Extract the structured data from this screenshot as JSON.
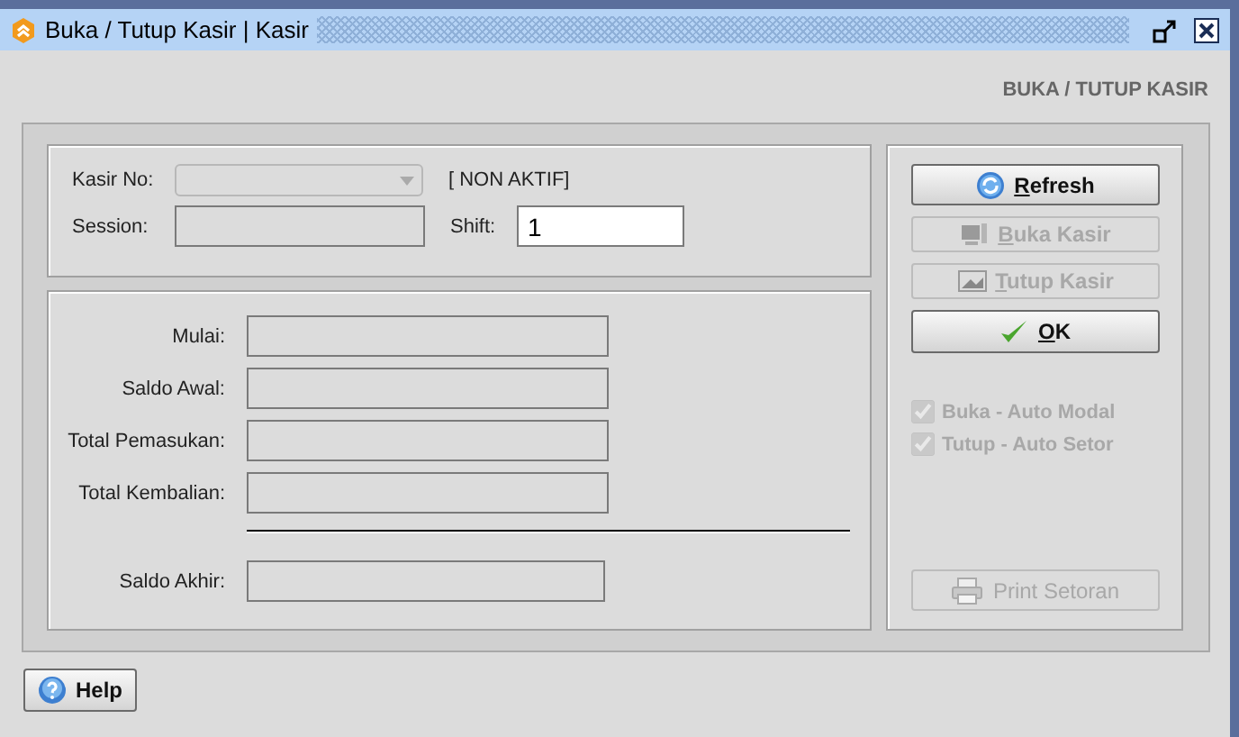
{
  "window": {
    "title": "Buka / Tutup Kasir | Kasir"
  },
  "heading": "BUKA / TUTUP KASIR",
  "session_panel": {
    "kasir_no": {
      "label": "Kasir No:",
      "disabled": true
    },
    "status": "[ NON AKTIF]",
    "session": {
      "label": "Session:",
      "disabled": true
    },
    "shift": {
      "label": "Shift:",
      "value": "1",
      "disabled": false
    }
  },
  "summary_fields": [
    {
      "label": "Mulai:",
      "disabled": true
    },
    {
      "label": "Saldo Awal:",
      "disabled": true
    },
    {
      "label": "Total Pemasukan:",
      "disabled": true
    },
    {
      "label": "Total Kembalian:",
      "disabled": true
    }
  ],
  "total_field": {
    "label": "Saldo Akhir:",
    "disabled": true
  },
  "actions": [
    {
      "kind": "refresh",
      "accel": "R",
      "rest": "efresh",
      "disabled": false
    },
    {
      "kind": "open",
      "accel": "B",
      "rest": "uka Kasir",
      "disabled": true
    },
    {
      "kind": "close",
      "accel": "T",
      "rest": "utup Kasir",
      "disabled": true
    },
    {
      "kind": "ok",
      "accel": "O",
      "rest": "K",
      "disabled": false
    }
  ],
  "options": [
    {
      "label": "Buka - Auto Modal",
      "checked": true,
      "disabled": true
    },
    {
      "label": "Tutup - Auto Setor",
      "checked": true,
      "disabled": true
    }
  ],
  "print_button": {
    "label": "Print Setoran",
    "disabled": true
  },
  "help_button": {
    "label": "Help"
  }
}
